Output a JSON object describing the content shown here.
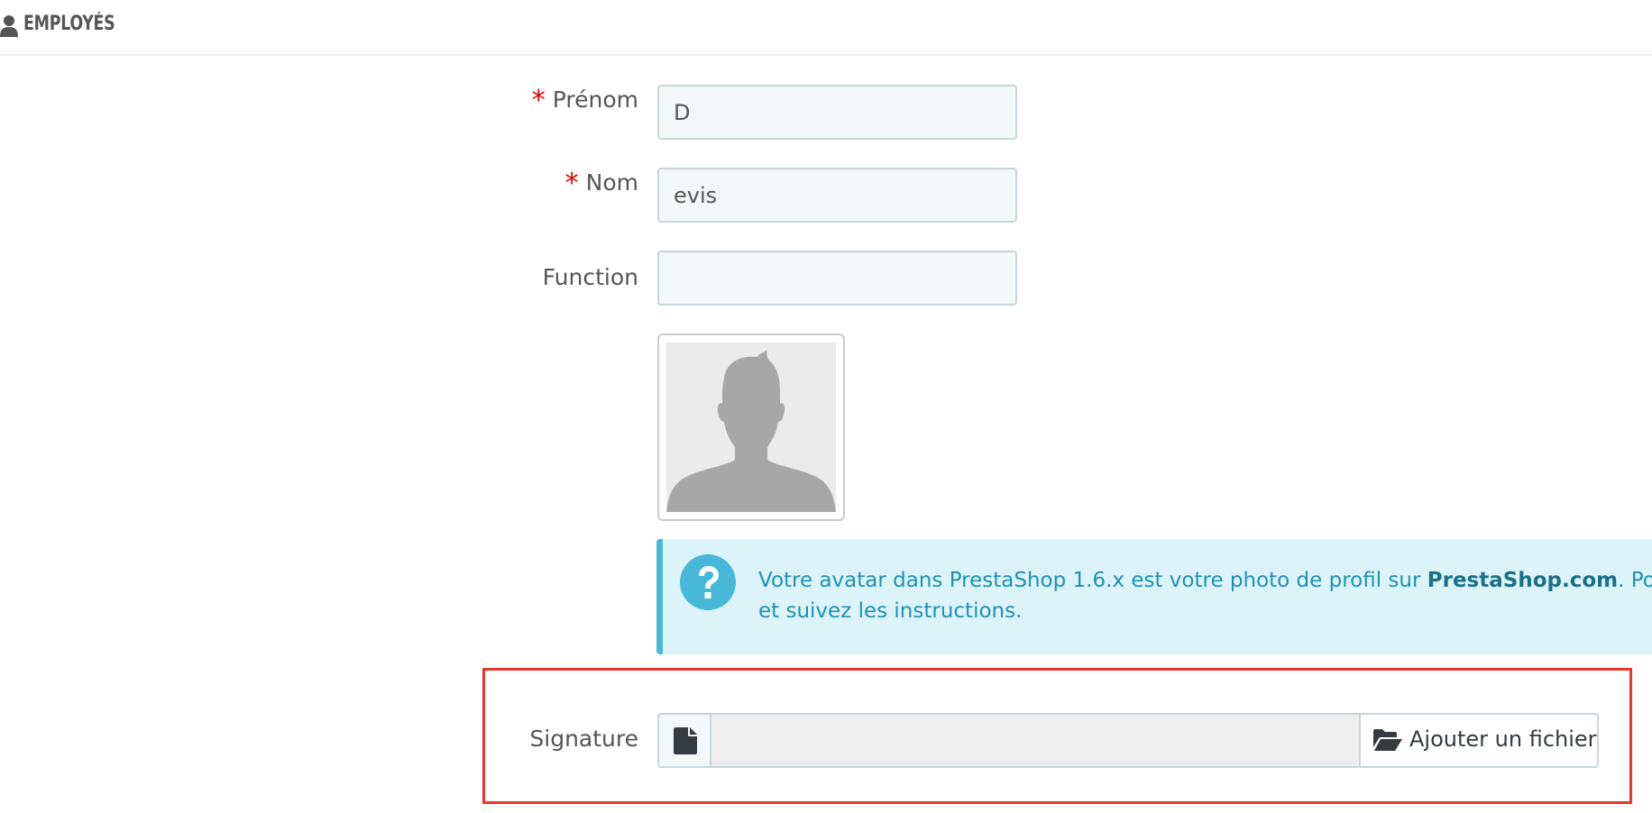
{
  "header": {
    "title": "EMPLOYÉS",
    "icon": "user-icon"
  },
  "form": {
    "firstname": {
      "required_marker": "*",
      "label": "Prénom",
      "value": "D"
    },
    "lastname": {
      "required_marker": "*",
      "label": "Nom",
      "value": "evis"
    },
    "function": {
      "label": "Function",
      "value": ""
    },
    "avatar": {
      "icon": "avatar-placeholder-icon"
    },
    "info": {
      "icon": "question-circle-icon",
      "line1_prefix": "Votre avatar dans PrestaShop 1.6.x est votre photo de profil sur ",
      "line1_bold": "PrestaShop.com",
      "line1_suffix": ". Pour cl",
      "line2": "et suivez les instructions."
    },
    "signature": {
      "label": "Signature",
      "file_icon": "file-icon",
      "filename": "",
      "button_icon": "folder-open-icon",
      "button_label": "Ajouter un fichier"
    }
  },
  "colors": {
    "required": "#e00000",
    "info_text": "#1e91b3",
    "info_bg": "#dcf4f9",
    "info_border": "#48b8d8",
    "highlight": "#e8362c"
  }
}
